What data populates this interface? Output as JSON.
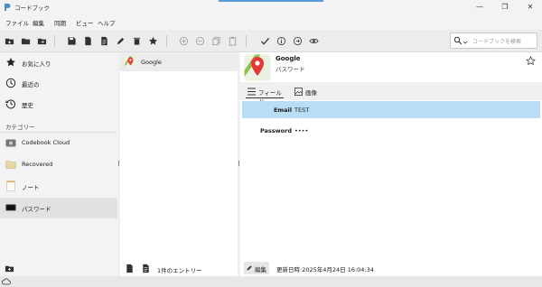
{
  "window": {
    "title": "コードブック",
    "controls": {
      "minimize": "—",
      "maximize": "❐",
      "close": "✕"
    }
  },
  "menu": [
    "ファイル",
    "編集",
    "同期",
    "ビュー",
    "ヘルプ"
  ],
  "search": {
    "placeholder": "コードブックを検索"
  },
  "sidebar": {
    "items": [
      {
        "label": "お気に入り",
        "icon": "star-icon"
      },
      {
        "label": "最近の",
        "icon": "clock-icon"
      },
      {
        "label": "歴史",
        "icon": "history-icon"
      }
    ],
    "categories_header": "カテゴリー",
    "categories": [
      {
        "label": "Codebook Cloud",
        "icon": "cloud-drive-icon"
      },
      {
        "label": "Recovered",
        "icon": "folder-icon"
      },
      {
        "label": "ノート",
        "icon": "note-icon"
      },
      {
        "label": "パスワード",
        "icon": "password-icon",
        "selected": true
      }
    ]
  },
  "entries": {
    "items": [
      {
        "label": "Google",
        "icon": "google-maps-pin-icon"
      }
    ],
    "count_text": "1件のエントリー"
  },
  "detail": {
    "title": "Google",
    "subtitle": "パスワード",
    "tabs": [
      {
        "label": "フィールド",
        "active": true
      },
      {
        "label": "画像"
      }
    ],
    "fields": [
      {
        "key": "Email",
        "value": "TEST",
        "selected": true
      },
      {
        "key": "Password",
        "value": "••••"
      }
    ],
    "edit_label": "編集",
    "updated": "更新日時:2025年4月24日 16:04:34"
  },
  "colors": {
    "selection": "#b7def3",
    "pin_red": "#e53935",
    "accent": "#5b9bd5"
  }
}
